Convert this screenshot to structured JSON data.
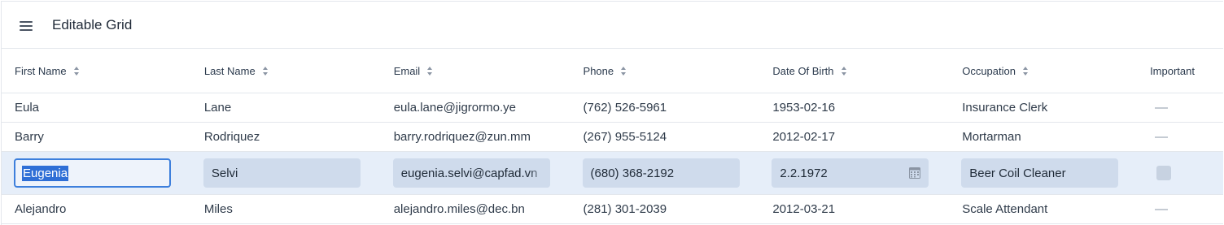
{
  "header": {
    "title": "Editable Grid"
  },
  "columns": [
    "First Name",
    "Last Name",
    "Email",
    "Phone",
    "Date Of Birth",
    "Occupation",
    "Important"
  ],
  "rows": [
    {
      "first": "Eula",
      "last": "Lane",
      "email": "eula.lane@jigrormo.ye",
      "phone": "(762) 526-5961",
      "dob": "1953-02-16",
      "occupation": "Insurance Clerk"
    },
    {
      "first": "Barry",
      "last": "Rodriquez",
      "email": "barry.rodriquez@zun.mm",
      "phone": "(267) 955-5124",
      "dob": "2012-02-17",
      "occupation": "Mortarman"
    }
  ],
  "editing": {
    "first": "Eugenia",
    "last": "Selvi",
    "email": "eugenia.selvi@capfad.vn",
    "phone": "(680) 368-2192",
    "dob": "2.2.1972",
    "occupation": "Beer Coil Cleaner",
    "important": false
  },
  "after_rows": [
    {
      "first": "Alejandro",
      "last": "Miles",
      "email": "alejandro.miles@dec.bn",
      "phone": "(281) 301-2039",
      "dob": "2012-03-21",
      "occupation": "Scale Attendant"
    }
  ],
  "icons": {
    "menu": "hamburger-menu-icon",
    "sort": "sort-icon",
    "calendar": "calendar-icon",
    "important_empty": "dash-icon"
  },
  "colors": {
    "accent": "#3d7fdc",
    "edit_row_bg": "#e6eef9",
    "field_bg": "#cfdbec"
  }
}
